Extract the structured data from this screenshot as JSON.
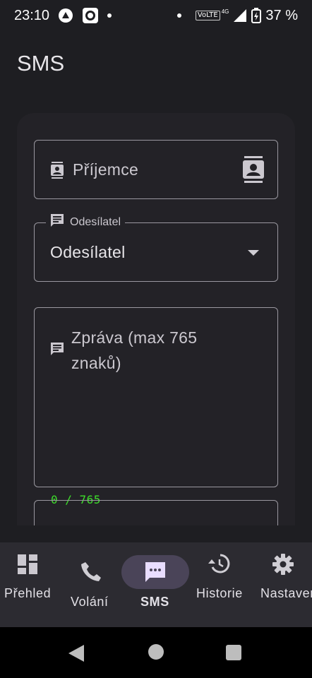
{
  "status_bar": {
    "time": "23:10",
    "network_label": "VoLTE",
    "network_type": "4G",
    "battery_percent": "37 %",
    "icons": [
      "app-a-icon",
      "camera-icon",
      "dot-icon",
      "dot-icon",
      "signal-icon",
      "battery-charging-icon"
    ]
  },
  "page": {
    "title": "SMS"
  },
  "form": {
    "recipient_placeholder": "Příjemce",
    "sender_label": "Odesílatel",
    "sender_value": "Odesílatel",
    "message_placeholder": "Zpráva (max 765 znaků)",
    "counter": "0 / 765"
  },
  "bottom_nav": {
    "items": [
      {
        "label": "Přehled",
        "icon": "dashboard-icon",
        "selected": false
      },
      {
        "label": "Volání",
        "icon": "phone-icon",
        "selected": false
      },
      {
        "label": "SMS",
        "icon": "sms-icon",
        "selected": true
      },
      {
        "label": "Historie",
        "icon": "history-icon",
        "selected": false
      },
      {
        "label": "Nastavení",
        "icon": "settings-icon",
        "selected": false
      }
    ]
  },
  "colors": {
    "background": "#1e1e22",
    "card": "#232227",
    "counter": "#3ddc2a",
    "nav_background": "#2c2b31",
    "nav_selected_pill": "#4a4458"
  }
}
